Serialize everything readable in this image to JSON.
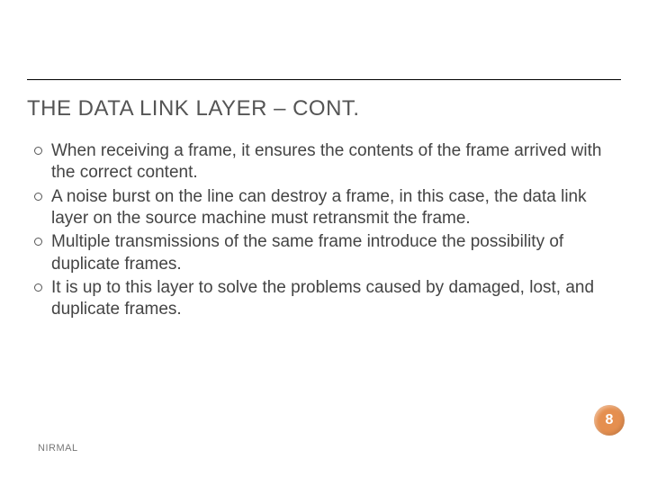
{
  "title": "THE DATA LINK LAYER – CONT.",
  "bullets": [
    "When receiving a frame, it ensures the contents of the frame arrived with the correct content.",
    "A noise burst on the line can destroy a frame, in this case, the data link layer on the source machine must retransmit the frame.",
    "Multiple transmissions of the same frame introduce the possibility of duplicate frames.",
    "It is up to this layer to solve the problems caused by damaged, lost, and duplicate frames."
  ],
  "page_number": "8",
  "footer": "NIRMAL"
}
